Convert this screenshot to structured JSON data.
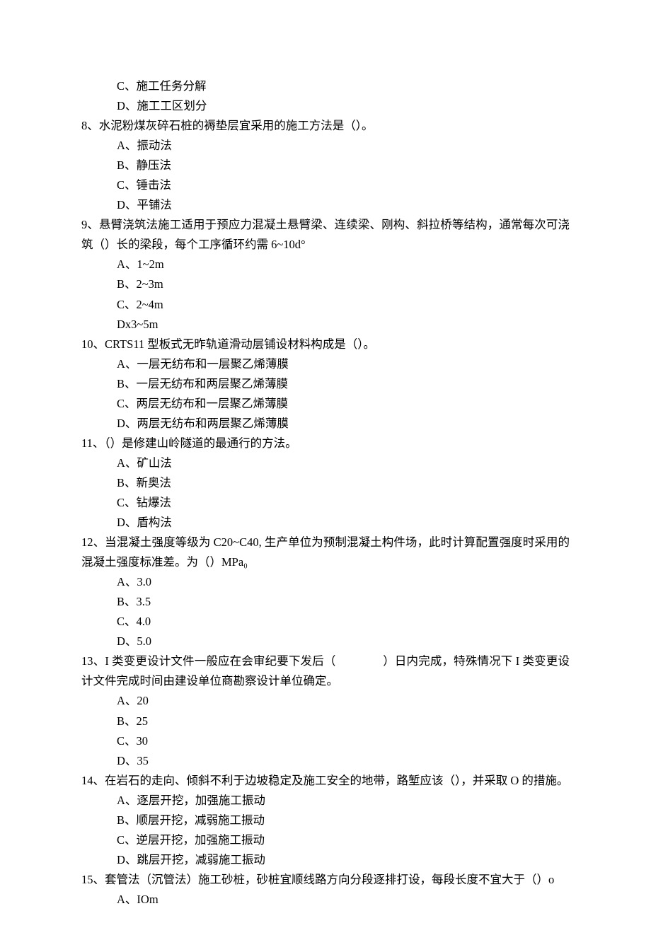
{
  "questions": [
    {
      "id": "q7-partial",
      "stem_lines": [],
      "options": [
        "C、施工任务分解",
        "D、施工工区划分"
      ]
    },
    {
      "id": "q8",
      "stem_lines": [
        "8、水泥粉煤灰碎石桩的褥垫层宜采用的施工方法是（）。"
      ],
      "options": [
        "A、振动法",
        "B、静压法",
        "C、锤击法",
        "D、平铺法"
      ]
    },
    {
      "id": "q9",
      "stem_lines": [
        "9、悬臂浇筑法施工适用于预应力混凝土悬臂梁、连续梁、刚构、斜拉桥等结构，通常每次可浇筑（）长的梁段，每个工序循环约需 6~10d°"
      ],
      "options": [
        "A、1~2m",
        "B、2~3m",
        "C、2~4m",
        "Dx3~5m"
      ]
    },
    {
      "id": "q10",
      "stem_lines": [
        "10、CRTS11 型板式无昨轨道滑动层铺设材料构成是（）。"
      ],
      "options": [
        "A、一层无纺布和一层聚乙烯薄膜",
        "B、一层无纺布和两层聚乙烯薄膜",
        "C、两层无纺布和一层聚乙烯薄膜",
        "D、两层无纺布和两层聚乙烯薄膜"
      ]
    },
    {
      "id": "q11",
      "stem_lines": [
        "11、（）是修建山岭隧道的最通行的方法。"
      ],
      "options": [
        "A、矿山法",
        "B、新奥法",
        "C、钻爆法",
        "D、盾构法"
      ]
    },
    {
      "id": "q12",
      "stem_lines": [
        "12、当混凝土强度等级为 C20~C40, 生产单位为预制混凝土构件场，此时计算配置强度时采用的混凝土强度标准差。为（）MPa₀"
      ],
      "options": [
        "A、3.0",
        "B、3.5",
        "C、4.0",
        "D、5.0"
      ]
    },
    {
      "id": "q13",
      "stem_lines": [
        "13、I 类变更设计文件一般应在会审纪要下发后（　　　　）日内完成，特殊情况下 I 类变更设计文件完成时间由建设单位商勘察设计单位确定。"
      ],
      "options": [
        "A、20",
        "B、25",
        "C、30",
        "D、35"
      ]
    },
    {
      "id": "q14",
      "stem_lines": [
        "14、在岩石的走向、倾斜不利于边坡稳定及施工安全的地带，路堑应该（），并采取 O 的措施。"
      ],
      "options": [
        "A、逐层开挖，加强施工振动",
        "B、顺层开挖，减弱施工振动",
        "C、逆层开挖，加强施工振动",
        "D、跳层开挖，减弱施工振动"
      ]
    },
    {
      "id": "q15",
      "stem_lines": [
        "15、套管法（沉管法）施工砂桩，砂桩宜顺线路方向分段逐排打设，每段长度不宜大于（）o"
      ],
      "options": [
        "A、IOm"
      ]
    }
  ]
}
